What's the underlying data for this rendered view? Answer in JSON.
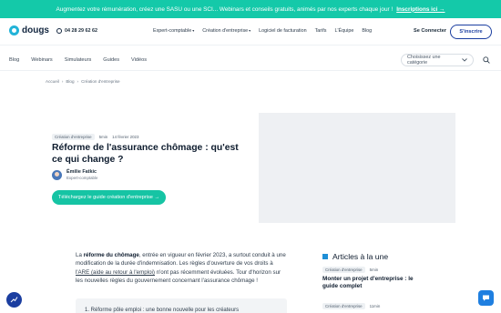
{
  "promo": {
    "text": "Augmentez votre rémunération, créez une SASU ou une SCI... Webinars et conseils gratuits, animés par nos experts chaque jour !",
    "link": "Inscriptions ici →"
  },
  "header": {
    "logo": "dougs",
    "phone": "04 28 29 62 62",
    "menu": [
      "Expert-comptable",
      "Création d'entreprise",
      "Logiciel de facturation",
      "Tarifs",
      "L'Équipe",
      "Blog"
    ],
    "connect": "Se Connecter",
    "signup": "S'inscrire"
  },
  "subnav": {
    "items": [
      "Blog",
      "Webinars",
      "Simulateurs",
      "Guides",
      "Vidéos"
    ],
    "category_placeholder": "Choisissez une catégorie"
  },
  "breadcrumb": [
    "Accueil",
    "Blog",
    "Création d'entreprise"
  ],
  "article": {
    "tag": "Création d'entreprise",
    "read_time": "5min",
    "date": "14 février 2023",
    "title": "Réforme de l'assurance chômage : qu'est ce qui change ?",
    "author_name": "Émilie Fatkic",
    "author_role": "Expert-comptable",
    "cta": "Téléchargez le guide création d'entreprise →",
    "intro_pre": "La ",
    "intro_bold": "réforme du chômage",
    "intro_mid": ", entrée en vigueur en février 2023, a surtout conduit à une modification de la durée d'indemnisation. Les règles d'ouverture de vos droits à ",
    "intro_link": "l'ARE (aide au retour à l'emploi)",
    "intro_post": " n'ont pas récemment évoluées. Tour d'horizon sur les nouvelles règles du gouvernement concernant l'assurance chômage !",
    "summary_item": "1. Réforme pôle emploi : une bonne nouvelle pour les créateurs"
  },
  "sidebar": {
    "title": "Articles à la une",
    "item1_tag": "Création d'entreprise",
    "item1_time": "5min",
    "item1_title": "Monter un projet d'entreprise : le guide complet",
    "item2_tag": "Création d'entreprise",
    "item2_time": "11min"
  },
  "colors": {
    "accent": "#16c4a4",
    "primary": "#1b3ea0",
    "sidebar_marker": "#1f8fd6"
  }
}
